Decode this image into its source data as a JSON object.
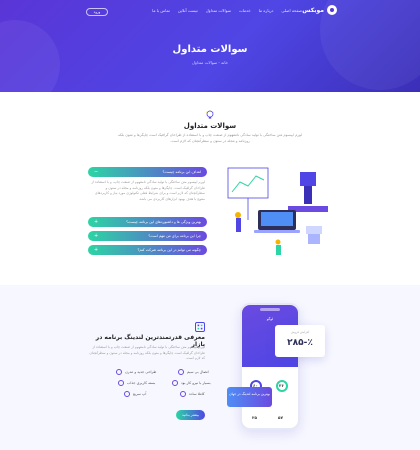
{
  "nav": {
    "brand": "موبکس",
    "links": [
      "صفحه اصلی",
      "درباره ما",
      "خدمات",
      "سوالات متداول",
      "تیست آنلاین",
      "تماس با ما"
    ],
    "button": "ورود"
  },
  "hero": {
    "title": "سوالات متداول",
    "breadcrumb": "خانه  -  سوالات متداول"
  },
  "faq": {
    "title": "سوالات متداول",
    "subtitle": "لورم ایپسوم متن ساختگی با تولید سادگی نامفهوم از صنعت چاپ و با استفاده از طراحان گرافیک است چاپگرها و متون بلکه روزنامه و مجله در ستون و سطرآنچنان که لازم است.",
    "items": [
      {
        "q": "اهداف این برنامه چیست؟",
        "open": true
      },
      {
        "q": "بهترین ویژگی ها و داشبوردهای این برنامه چیست؟",
        "open": false
      },
      {
        "q": "چرا این برنامه برای من مهم است؟",
        "open": false
      },
      {
        "q": "چگونه می توانم در این برنامه شرکت کنم؟",
        "open": false
      }
    ],
    "answer": "لورم ایپسوم متن ساختگی با تولید سادگی نامفهوم از صنعت چاپ، و با استفاده از طراحان گرافیک است. چاپگرها و متون بلکه روزنامه و مجله در ستون و سطرآنچنان که لازم است و برای شرایط فعلی تکنولوژی مورد نیاز و کاربردهای متنوع با هدف بهبود ابزارهای کاربردی می باشد.",
    "toggle_open": "−",
    "toggle_closed": "+"
  },
  "feature": {
    "title": "معرفی قدرتمندترین لندینگ برنامه در بازار",
    "subtitle": "لورم ایپسوم متن ساختگی با تولید سادگی نامفهوم از صنعت چاپ و با استفاده از طراحان گرافیک است چاپگرها و متون بلکه روزنامه و مجله در ستون و سطرآنچنان که لازم است.",
    "items": [
      "اتصال بی سیم",
      "بسیار با نیرو کار بود",
      "کاملا ساده",
      "طراحی جدید و مدرن",
      "بسته کاربری جذاب",
      "آپ سریع"
    ],
    "button": "بیشتر بدانید"
  },
  "phone": {
    "header": "لوگو",
    "stat_value": "۲۸۵-٪",
    "stat_label": "افزایش فروش",
    "ring1": "۶۰",
    "ring2": "۳۶",
    "bottom_a": "۲۵",
    "bottom_b": "۵۷",
    "note": "بهترین برنامه لندینگ در جهان"
  },
  "colors": {
    "primary": "#4f46e5",
    "accent": "#2dd4a4"
  }
}
